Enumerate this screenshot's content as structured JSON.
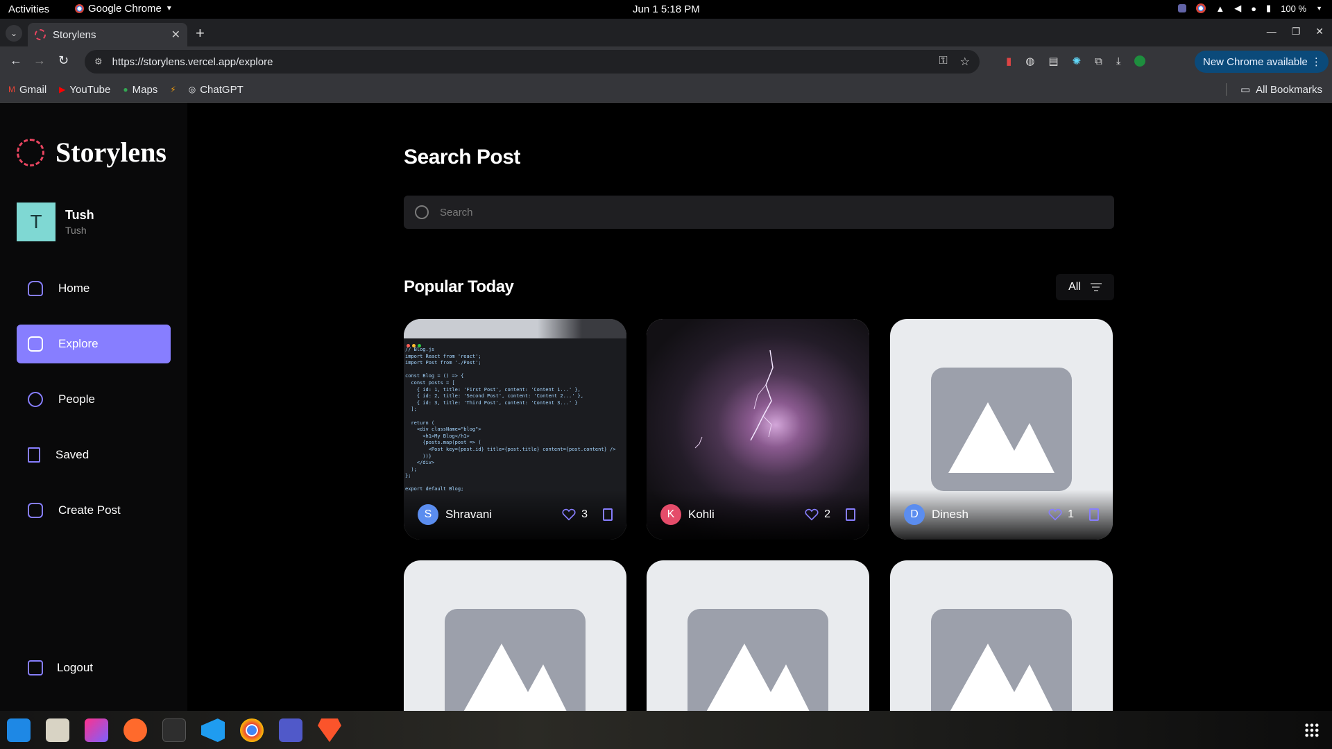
{
  "system": {
    "activities": "Activities",
    "app_name": "Google Chrome",
    "clock": "Jun 1  5:18 PM",
    "battery": "100 %"
  },
  "browser": {
    "tab_title": "Storylens",
    "url": "https://storylens.vercel.app/explore",
    "new_chrome": "New Chrome available",
    "bookmarks": [
      "Gmail",
      "YouTube",
      "Maps",
      "ChatGPT"
    ],
    "all_bookmarks": "All Bookmarks"
  },
  "sidebar": {
    "logo": "Storylens",
    "user": {
      "initial": "T",
      "name": "Tush",
      "handle": "Tush"
    },
    "items": [
      {
        "label": "Home",
        "icon": "home-icon"
      },
      {
        "label": "Explore",
        "icon": "explore-icon"
      },
      {
        "label": "People",
        "icon": "people-icon"
      },
      {
        "label": "Saved",
        "icon": "bookmark-icon"
      },
      {
        "label": "Create Post",
        "icon": "create-post-icon"
      }
    ],
    "logout": "Logout"
  },
  "main": {
    "title": "Search Post",
    "search_placeholder": "Search",
    "section_title": "Popular Today",
    "filter_label": "All"
  },
  "posts": [
    {
      "author": "Shravani",
      "initial": "S",
      "likes": "3",
      "avatar_color": "#5b8def",
      "image": "code-screenshot"
    },
    {
      "author": "Kohli",
      "initial": "K",
      "likes": "2",
      "avatar_color": "#e54c6a",
      "image": "lightning-storm"
    },
    {
      "author": "Dinesh",
      "initial": "D",
      "likes": "1",
      "avatar_color": "#5b8def",
      "image": "placeholder"
    },
    {
      "image": "placeholder"
    },
    {
      "image": "placeholder"
    },
    {
      "image": "placeholder"
    }
  ],
  "colors": {
    "accent": "#877eff",
    "logo": "#e94560",
    "avatar_bg": "#7fd8d3"
  }
}
